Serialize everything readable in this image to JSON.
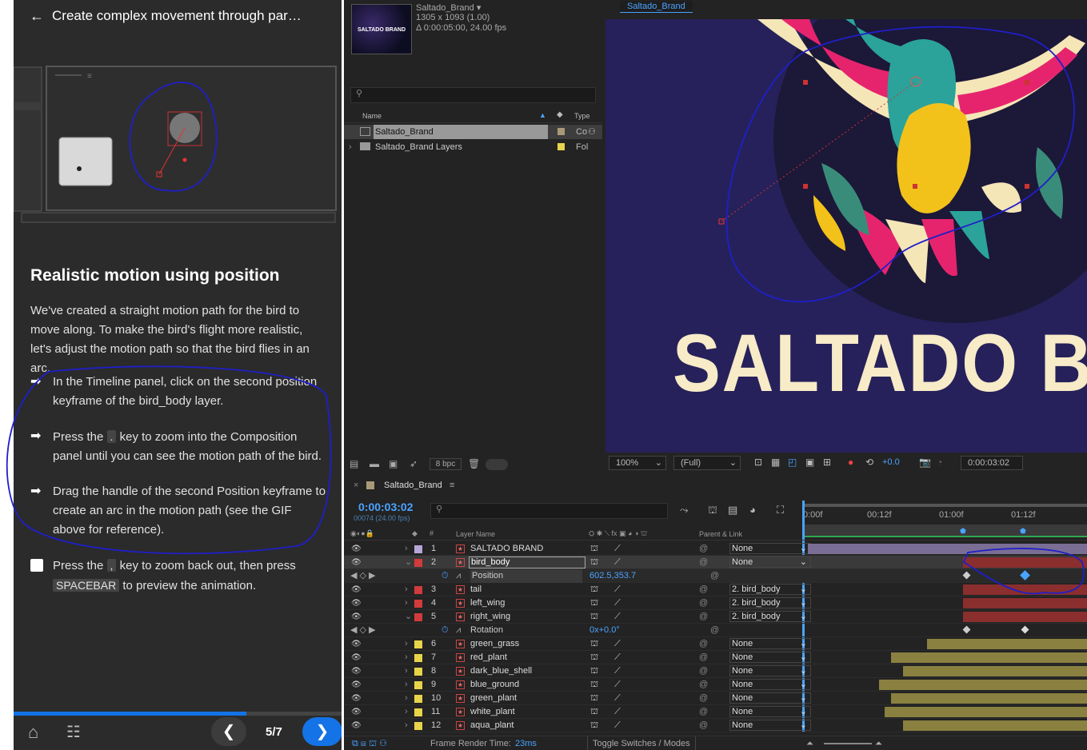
{
  "tutorial": {
    "header_title": "Create complex movement through par…",
    "heading": "Realistic motion using position",
    "intro": "We've created a straight motion path for the bird to move along. To make the bird's flight more realistic, let's adjust the motion path so that the bird flies in an arc.",
    "steps": [
      {
        "text": "In the Timeline panel, click on the second position keyframe of the bird_body layer."
      },
      {
        "pre": "Press the",
        "key": ".",
        "post": "key to zoom into the Composition panel until you can see the motion path of the bird."
      },
      {
        "text": "Drag the handle of the second Position keyframe to create an arc in the motion path (see the GIF above for reference)."
      },
      {
        "pre": "Press the",
        "key": ",",
        "post": "key to zoom back out, then press",
        "key2": "SPACEBAR",
        "post2": "to preview the animation."
      }
    ],
    "progress": 0.71,
    "page": "5/7",
    "prev_icon": "chevron-left-icon",
    "next_icon": "chevron-right-icon"
  },
  "project": {
    "comp_name": "Saltado_Brand",
    "dims": "1305 x 1093 (1.00)",
    "duration": "Δ 0:00:05:00, 24.00 fps",
    "thumb_text": "SALTADO BRAND",
    "col_name": "Name",
    "col_type": "Type",
    "items": [
      {
        "name": "Saltado_Brand",
        "type": "Co",
        "color": "#a89a78"
      },
      {
        "name": "Saltado_Brand Layers",
        "type": "Fol",
        "color": "#e8d44a"
      }
    ],
    "bpc": "8 bpc"
  },
  "viewer": {
    "tab": "Saltado_Brand",
    "comp_text": "SALTADO BRA",
    "zoom": "100%",
    "resolution": "(Full)",
    "exposure": "+0.0",
    "time": "0:00:03:02"
  },
  "timeline": {
    "tab": "Saltado_Brand",
    "timecode": "0:00:03:02",
    "fps": "00074 (24.00 fps)",
    "ruler": [
      "0:00f",
      "00:12f",
      "01:00f",
      "01:12f"
    ],
    "col_layer": "Layer Name",
    "col_parent": "Parent & Link",
    "layers": [
      {
        "num": "1",
        "name": "SALTADO BRAND",
        "parent": "None",
        "color": "#b7a6d9",
        "bar_color": "#7b6e94",
        "start": 0
      },
      {
        "num": "2",
        "name": "bird_body",
        "parent": "None",
        "color": "#d23b3b",
        "bar_color": "#8a2e2e",
        "start": 200,
        "selected": true
      },
      {
        "prop": "Position",
        "value": "602.5,353.7"
      },
      {
        "num": "3",
        "name": "tail",
        "parent": "2. bird_body",
        "color": "#d23b3b",
        "bar_color": "#8a2e2e",
        "start": 200
      },
      {
        "num": "4",
        "name": "left_wing",
        "parent": "2. bird_body",
        "color": "#d23b3b",
        "bar_color": "#8a2e2e",
        "start": 200
      },
      {
        "num": "5",
        "name": "right_wing",
        "parent": "2. bird_body",
        "color": "#d23b3b",
        "bar_color": "#8a2e2e",
        "start": 200
      },
      {
        "prop": "Rotation",
        "value": "0x+0.0°"
      },
      {
        "num": "6",
        "name": "green_grass",
        "parent": "None",
        "color": "#e8d44a",
        "bar_color": "#8a8040",
        "start": 155
      },
      {
        "num": "7",
        "name": "red_plant",
        "parent": "None",
        "color": "#e8d44a",
        "bar_color": "#8a8040",
        "start": 110
      },
      {
        "num": "8",
        "name": "dark_blue_shell",
        "parent": "None",
        "color": "#e8d44a",
        "bar_color": "#8a8040",
        "start": 125
      },
      {
        "num": "9",
        "name": "blue_ground",
        "parent": "None",
        "color": "#e8d44a",
        "bar_color": "#8a8040",
        "start": 95
      },
      {
        "num": "10",
        "name": "green_plant",
        "parent": "None",
        "color": "#e8d44a",
        "bar_color": "#8a8040",
        "start": 110
      },
      {
        "num": "11",
        "name": "white_plant",
        "parent": "None",
        "color": "#e8d44a",
        "bar_color": "#8a8040",
        "start": 102
      },
      {
        "num": "12",
        "name": "aqua_plant",
        "parent": "None",
        "color": "#e8d44a",
        "bar_color": "#8a8040",
        "start": 125
      }
    ],
    "status_label": "Frame Render Time:",
    "status_value": "23ms",
    "toggle": "Toggle Switches / Modes"
  },
  "colors": {
    "accent": "#1473e6",
    "annotation": "#1f1fc8"
  }
}
